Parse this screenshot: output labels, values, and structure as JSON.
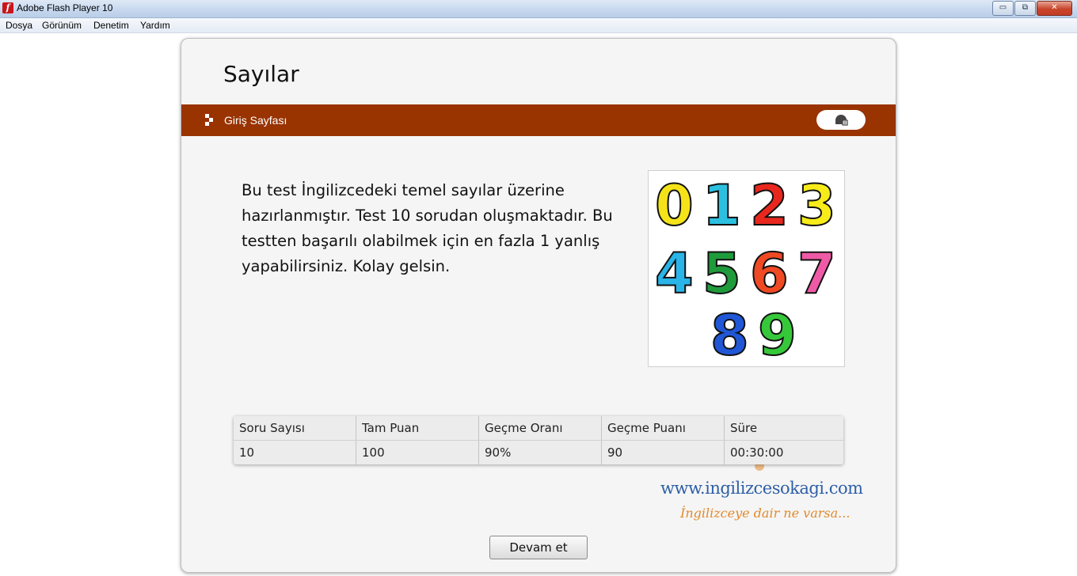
{
  "window": {
    "title": "Adobe Flash Player 10",
    "controls": {
      "minimize": "▭",
      "restore": "⧉",
      "close": "✕"
    }
  },
  "menu": [
    "Dosya",
    "Görünüm",
    "Denetim",
    "Yardım"
  ],
  "page": {
    "title": "Sayılar",
    "nav_label": "Giriş Sayfası",
    "description": "Bu test İngilizcedeki temel sayılar üzerine hazırlanmıştır. Test 10 sorudan oluşmaktadır. Bu testten başarılı olabilmek için en fazla 1 yanlış yapabilirsiniz. Kolay gelsin.",
    "numbers_image_digits": [
      "0",
      "1",
      "2",
      "3",
      "4",
      "5",
      "6",
      "7",
      "8",
      "9"
    ]
  },
  "table": {
    "headers": [
      "Soru Sayısı",
      "Tam Puan",
      "Geçme Oranı",
      "Geçme Puanı",
      "Süre"
    ],
    "values": [
      "10",
      "100",
      "90%",
      "90",
      "00:30:00"
    ]
  },
  "watermark": {
    "url": "www.ingilizcesokagi.com",
    "slogan": "İngilizceye dair ne varsa..."
  },
  "continue_label": "Devam et",
  "colors": {
    "nav_bar": "#993300",
    "card_bg": "#f5f5f5",
    "watermark_url": "#2e5fa6",
    "watermark_slogan": "#e08a2c"
  }
}
